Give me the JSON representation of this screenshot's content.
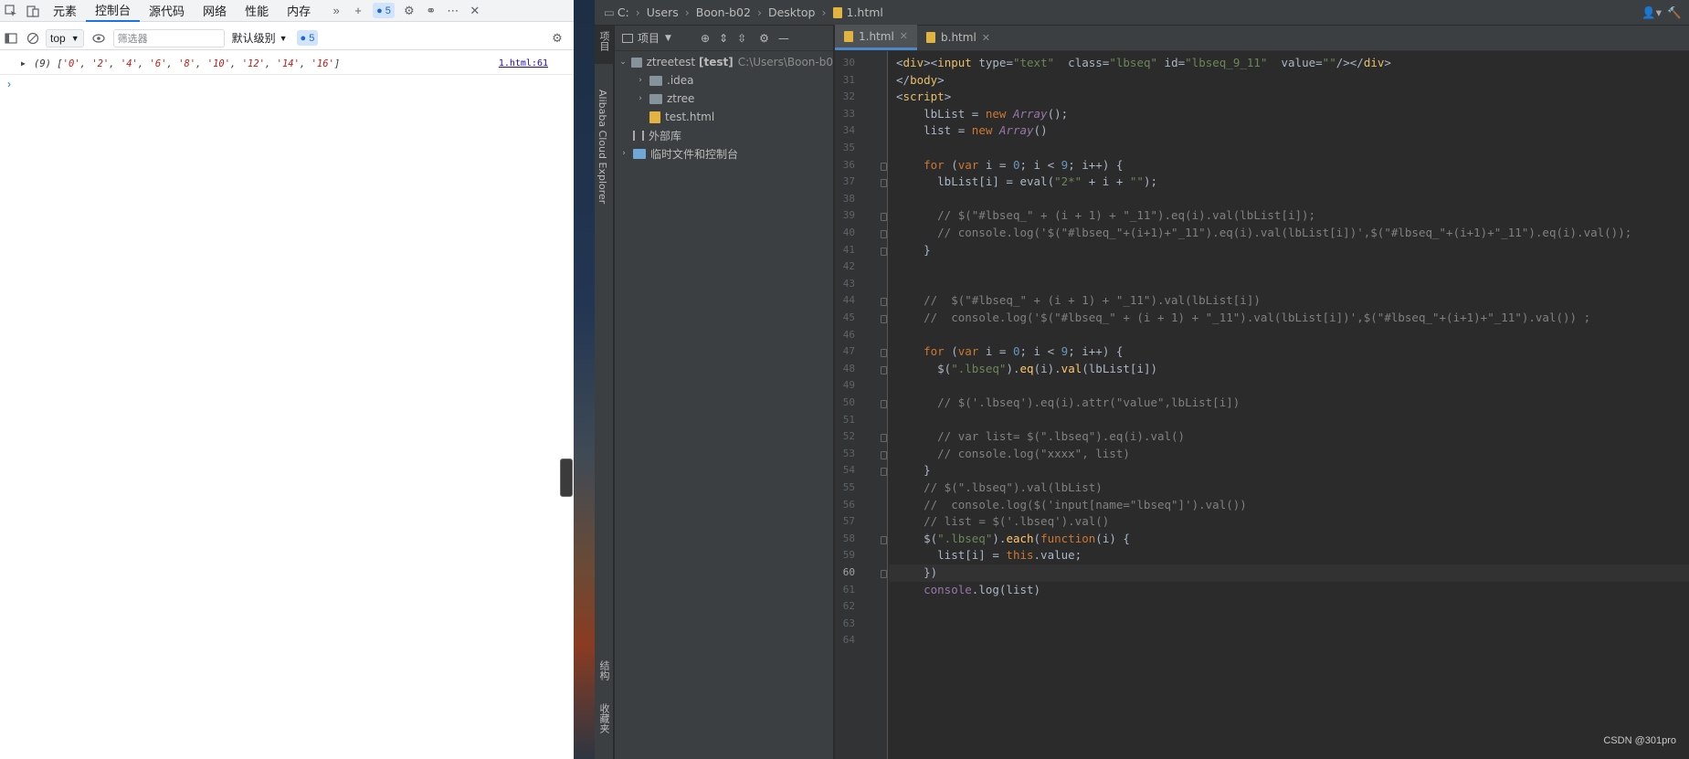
{
  "devtools": {
    "tabs": [
      {
        "label": "元素",
        "active": false
      },
      {
        "label": "控制台",
        "active": true
      },
      {
        "label": "源代码",
        "active": false
      },
      {
        "label": "网络",
        "active": false
      },
      {
        "label": "性能",
        "active": false
      },
      {
        "label": "内存",
        "active": false
      }
    ],
    "issues_count": "5",
    "context_select": "top",
    "filter_placeholder": "筛选器",
    "level_select": "默认级别",
    "toolbar_issues_count": "5",
    "console_log": {
      "count": "(9)",
      "array_open": "[",
      "items": [
        "'0'",
        "'2'",
        "'4'",
        "'6'",
        "'8'",
        "'10'",
        "'12'",
        "'14'",
        "'16'"
      ],
      "array_close": "]",
      "source": "1.html:61"
    },
    "prompt_symbol": "›"
  },
  "ide": {
    "breadcrumb": [
      "C:",
      "Users",
      "Boon-b02",
      "Desktop",
      "1.html"
    ],
    "left_strip": {
      "project_tab": "项目",
      "cloud_tab": "Alibaba Cloud Explorer",
      "structure_tab": "结构",
      "favorites_tab": "收藏夹"
    },
    "project_panel": {
      "title": "项目",
      "tree": [
        {
          "label": "ztreetest",
          "suffix": "[test]",
          "path": "C:\\Users\\Boon-b0"
        },
        {
          "label": ".idea"
        },
        {
          "label": "ztree"
        },
        {
          "label": "test.html"
        },
        {
          "label": "外部库"
        },
        {
          "label": "临时文件和控制台"
        }
      ]
    },
    "editor_tabs": [
      {
        "label": "1.html",
        "active": true
      },
      {
        "label": "b.html",
        "active": false
      }
    ],
    "code_lines": [
      {
        "n": "30",
        "text": "<div><input type=\"text\"  class=\"lbseq\" id=\"lbseq_9_11\"  value=\"\"/></div>"
      },
      {
        "n": "31",
        "text": "</body>"
      },
      {
        "n": "32",
        "text": "<script>"
      },
      {
        "n": "33",
        "text": "    lbList = new Array();"
      },
      {
        "n": "34",
        "text": "    list = new Array()"
      },
      {
        "n": "35",
        "text": ""
      },
      {
        "n": "36",
        "text": "    for (var i = 0; i < 9; i++) {"
      },
      {
        "n": "37",
        "text": "      lbList[i] = eval(\"2*\" + i + \"\");"
      },
      {
        "n": "38",
        "text": ""
      },
      {
        "n": "39",
        "text": "      // $(\"#lbseq_\" + (i + 1) + \"_11\").eq(i).val(lbList[i]);"
      },
      {
        "n": "40",
        "text": "      // console.log('$(\"#lbseq_\"+(i+1)+\"_11\").eq(i).val(lbList[i])',$(\"#lbseq_\"+(i+1)+\"_11\").eq(i).val());"
      },
      {
        "n": "41",
        "text": "    }"
      },
      {
        "n": "42",
        "text": ""
      },
      {
        "n": "43",
        "text": ""
      },
      {
        "n": "44",
        "text": "    //  $(\"#lbseq_\" + (i + 1) + \"_11\").val(lbList[i])"
      },
      {
        "n": "45",
        "text": "    //  console.log('$(\"#lbseq_\" + (i + 1) + \"_11\").val(lbList[i])',$(\"#lbseq_\"+(i+1)+\"_11\").val()) ;"
      },
      {
        "n": "46",
        "text": ""
      },
      {
        "n": "47",
        "text": "    for (var i = 0; i < 9; i++) {"
      },
      {
        "n": "48",
        "text": "      $(\".lbseq\").eq(i).val(lbList[i])"
      },
      {
        "n": "49",
        "text": ""
      },
      {
        "n": "50",
        "text": "      // $('.lbseq').eq(i).attr(\"value\",lbList[i])"
      },
      {
        "n": "51",
        "text": ""
      },
      {
        "n": "52",
        "text": "      // var list= $(\".lbseq\").eq(i).val()"
      },
      {
        "n": "53",
        "text": "      // console.log(\"xxxx\", list)"
      },
      {
        "n": "54",
        "text": "    }"
      },
      {
        "n": "55",
        "text": "    // $(\".lbseq\").val(lbList)"
      },
      {
        "n": "56",
        "text": "    //  console.log($('input[name=\"lbseq\"]').val())"
      },
      {
        "n": "57",
        "text": "    // list = $('.lbseq').val()"
      },
      {
        "n": "58",
        "text": "    $(\".lbseq\").each(function(i) {"
      },
      {
        "n": "59",
        "text": "      list[i] = this.value;"
      },
      {
        "n": "60",
        "text": "    })"
      },
      {
        "n": "61",
        "text": "    console.log(list)"
      },
      {
        "n": "62",
        "text": ""
      },
      {
        "n": "63",
        "text": ""
      },
      {
        "n": "64",
        "text": ""
      }
    ],
    "current_line": "60",
    "watermark": "CSDN @301pro"
  },
  "colors": {
    "devtools_accent": "#1a73e8",
    "ide_bg": "#2b2b2b",
    "ide_panel": "#3c3f41",
    "keyword": "#cc7832",
    "string": "#6a8759",
    "number": "#6897bb",
    "comment": "#808080"
  }
}
